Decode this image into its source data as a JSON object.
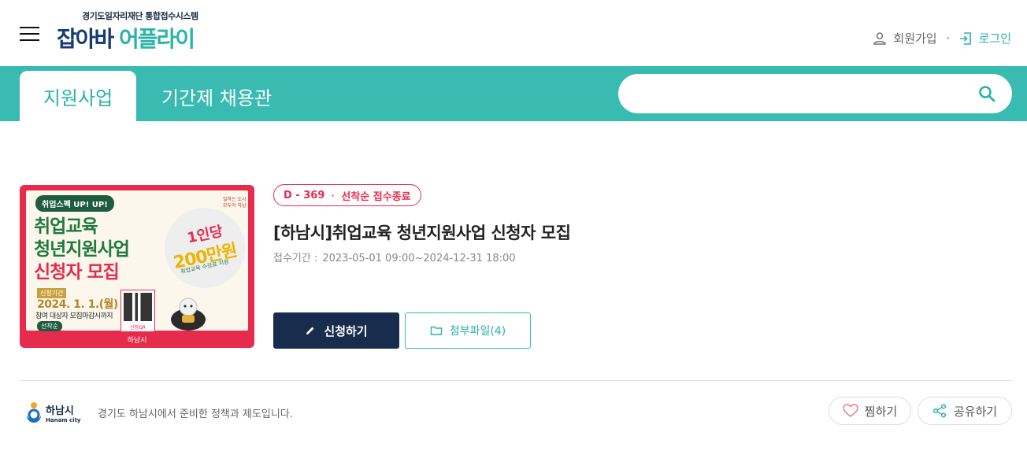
{
  "header": {
    "logo_sub": "경기도일자리재단 통합접수시스템",
    "logo_part1": "잡아바 ",
    "logo_part2": "어플라이",
    "signup_label": "회원가입",
    "login_label": "로그인"
  },
  "nav": {
    "tabs": [
      {
        "label": "지원사업",
        "active": true
      },
      {
        "label": "기간제 채용관",
        "active": false
      }
    ],
    "search": {
      "placeholder": "",
      "value": ""
    }
  },
  "listing": {
    "thumbnail": {
      "tag": "취업스펙 UP! UP!",
      "title_line1": "취업교육",
      "title_line2": "청년지원사업",
      "title_line3": "신청자 모집",
      "date_label": "신청기간",
      "date": "2024. 1. 1.(월) ~",
      "note": "참여 대상자 모집마감시까지",
      "badge": "선착순",
      "bubble_line1": "1인당",
      "bubble_line2": "200만원",
      "bubble_line3": "취업교육 수강료 지원",
      "qr_label": "신청QR",
      "stamp_line1": "일하는 도시",
      "stamp_line2": "모두의 하남",
      "footer": "하남시"
    },
    "dday": "D - 369",
    "status": "선착순 접수종료",
    "title": "[하남시]취업교육 청년지원사업 신청자 모집",
    "period_label": "접수기간 :",
    "period_value": "2023-05-01 09:00~2024-12-31 18:00",
    "apply_label": "신청하기",
    "attachment_label": "첨부파일(4)"
  },
  "footer": {
    "org_name": "하남시",
    "org_name_en": "Hanam city",
    "description": "경기도 하남시에서 준비한 정책과 제도입니다.",
    "like_label": "찜하기",
    "share_label": "공유하기"
  },
  "colors": {
    "teal": "#39bbb1",
    "navy": "#182d4d",
    "red": "#e72b4d"
  }
}
